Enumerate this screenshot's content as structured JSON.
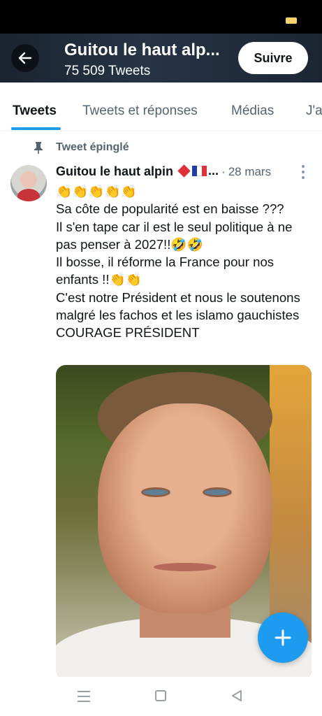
{
  "header": {
    "profile_name": "Guitou le haut alp...",
    "tweet_count": "75 509 Tweets",
    "follow_label": "Suivre"
  },
  "tabs": [
    {
      "label": "Tweets",
      "active": true
    },
    {
      "label": "Tweets et réponses",
      "active": false
    },
    {
      "label": "Médias",
      "active": false
    },
    {
      "label": "J'a",
      "active": false
    }
  ],
  "pinned": {
    "label": "Tweet épinglé"
  },
  "tweet": {
    "author": "Guitou le haut alpin",
    "author_suffix": "...",
    "separator": "·",
    "date": "28 mars",
    "text": "👏👏👏👏👏\nSa côte de popularité est en baisse ???\nIl s'en tape car il est le seul politique à ne pas penser à 2027!!🤣🤣\nIl bosse, il réforme la France pour nos enfants !!👏👏\nC'est notre Président et nous le soutenons malgré les fachos et les islamo gauchistes\nCOURAGE PRÉSIDENT"
  },
  "colors": {
    "accent": "#1d9bf0",
    "header_bg": "#1b2430",
    "text_primary": "#0f1419",
    "text_secondary": "#536471"
  },
  "icons": {
    "back": "arrow-left-icon",
    "pin": "pin-icon",
    "more": "more-vertical-icon",
    "compose": "plus-icon",
    "nav_menu": "menu-icon",
    "nav_home": "home-square-icon",
    "nav_back": "triangle-back-icon"
  }
}
